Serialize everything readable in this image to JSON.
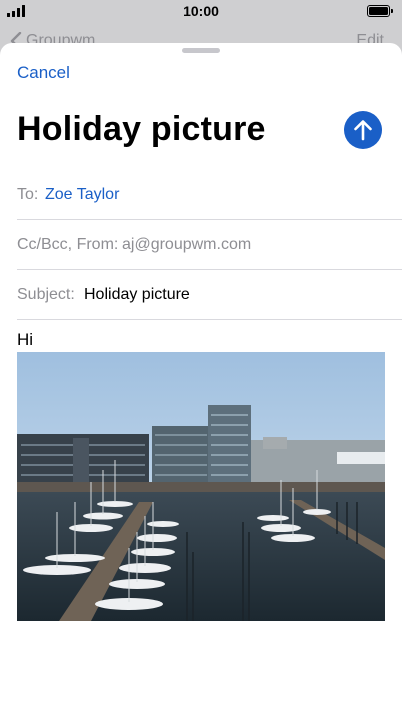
{
  "status_bar": {
    "time": "10:00"
  },
  "background_nav": {
    "back_label": "Groupwm",
    "edit_label": "Edit"
  },
  "compose": {
    "cancel_label": "Cancel",
    "title": "Holiday picture",
    "to_label": "To:",
    "to_value": "Zoe Taylor",
    "cc_label": "Cc/Bcc, From:",
    "cc_value": "aj@groupwm.com",
    "subject_label": "Subject:",
    "subject_value": "Holiday picture",
    "body_text": "Hi"
  },
  "colors": {
    "accent": "#1a5fc7",
    "secondary_text": "#8e8e93",
    "divider": "#d9d9de"
  },
  "icons": [
    "signal-icon",
    "battery-icon",
    "chevron-left-icon",
    "arrow-up-icon"
  ]
}
